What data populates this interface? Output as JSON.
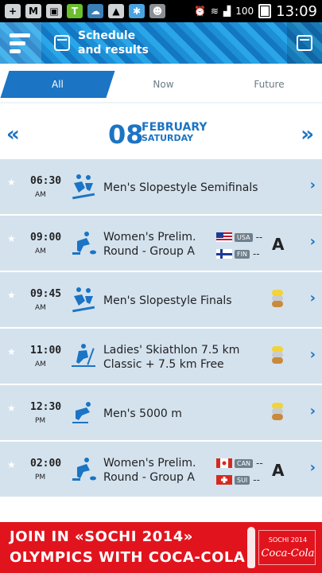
{
  "statusbar": {
    "battery": "100",
    "time": "13:09"
  },
  "header": {
    "title_line1": "Schedule",
    "title_line2": "and results"
  },
  "tabs": [
    {
      "label": "All",
      "active": true
    },
    {
      "label": "Now",
      "active": false
    },
    {
      "label": "Future",
      "active": false
    }
  ],
  "date": {
    "day": "08",
    "month": "FEBRUARY",
    "weekday": "SATURDAY"
  },
  "events": [
    {
      "time": "06:30",
      "ampm": "AM",
      "sport_icon": "snowboard-slopestyle-icon",
      "name": "Men's Slopestyle Semifinals"
    },
    {
      "time": "09:00",
      "ampm": "AM",
      "sport_icon": "curling-icon",
      "name_line1": "Women's Prelim.",
      "name_line2": "Round - Group A",
      "teams": [
        {
          "code": "USA",
          "score": "--"
        },
        {
          "code": "FIN",
          "score": "--"
        }
      ],
      "group": "A"
    },
    {
      "time": "09:45",
      "ampm": "AM",
      "sport_icon": "snowboard-slopestyle-icon",
      "name": "Men's Slopestyle Finals",
      "medal": true
    },
    {
      "time": "11:00",
      "ampm": "AM",
      "sport_icon": "skiathlon-icon",
      "name_line1": "Ladies' Skiathlon 7.5 km",
      "name_line2": "Classic + 7.5 km Free",
      "medal": true
    },
    {
      "time": "12:30",
      "ampm": "PM",
      "sport_icon": "speed-skating-icon",
      "name": "Men's 5000 m",
      "medal": true
    },
    {
      "time": "02:00",
      "ampm": "PM",
      "sport_icon": "curling-icon",
      "name_line1": "Women's Prelim.",
      "name_line2": "Round - Group A",
      "teams": [
        {
          "code": "CAN",
          "score": "--"
        },
        {
          "code": "SUI",
          "score": "--"
        }
      ],
      "group": "A"
    }
  ],
  "banner": {
    "line1": "JOIN IN «SOCHI 2014»",
    "line2": "OLYMPICS WITH COCA-COLA"
  },
  "colors": {
    "accent": "#1b74c4",
    "row_bg": "#d4e2ee",
    "banner_bg": "#e1141e"
  }
}
